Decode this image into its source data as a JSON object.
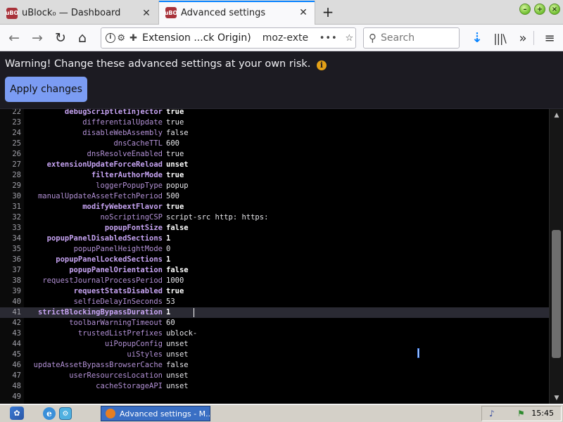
{
  "browser": {
    "tabs": [
      {
        "favicon": "uBO",
        "title": "uBlock₀ — Dashboard",
        "active": false
      },
      {
        "favicon": "uBO",
        "title": "Advanced settings",
        "active": true
      }
    ],
    "new_tab_icon": "+",
    "window_buttons": {
      "minimize": "–",
      "maximize": "+",
      "close": "×"
    },
    "nav": {
      "back_icon": "←",
      "forward_icon": "→",
      "reload_icon": "↻",
      "home_icon": "⌂",
      "identity_label": "Extension ...ck Origin)",
      "url": "moz-exte",
      "page_actions_icon": "•••",
      "bookmark_icon": "☆",
      "search_placeholder": "Search",
      "downloads_icon": "⇣",
      "library_icon": "|||\\",
      "overflow_icon": "»",
      "menu_icon": "≡"
    }
  },
  "page": {
    "warning": "Warning! Change these advanced settings at your own risk.",
    "warning_icon": "i",
    "apply_button": "Apply changes"
  },
  "editor": {
    "active_line": 41,
    "lines": [
      {
        "n": "22",
        "key": "debugScriptletInjector",
        "value": "true",
        "modified": true
      },
      {
        "n": "23",
        "key": "differentialUpdate",
        "value": "true",
        "modified": false
      },
      {
        "n": "24",
        "key": "disableWebAssembly",
        "value": "false",
        "modified": false
      },
      {
        "n": "25",
        "key": "dnsCacheTTL",
        "value": "600",
        "modified": false
      },
      {
        "n": "26",
        "key": "dnsResolveEnabled",
        "value": "true",
        "modified": false
      },
      {
        "n": "27",
        "key": "extensionUpdateForceReload",
        "value": "unset",
        "modified": true
      },
      {
        "n": "28",
        "key": "filterAuthorMode",
        "value": "true",
        "modified": true
      },
      {
        "n": "29",
        "key": "loggerPopupType",
        "value": "popup",
        "modified": false
      },
      {
        "n": "30",
        "key": "manualUpdateAssetFetchPeriod",
        "value": "500",
        "modified": false
      },
      {
        "n": "31",
        "key": "modifyWebextFlavor",
        "value": "true",
        "modified": true
      },
      {
        "n": "32",
        "key": "noScriptingCSP",
        "value": "script-src http: https:",
        "modified": false
      },
      {
        "n": "33",
        "key": "popupFontSize",
        "value": "false",
        "modified": true
      },
      {
        "n": "34",
        "key": "popupPanelDisabledSections",
        "value": "1",
        "modified": true
      },
      {
        "n": "35",
        "key": "popupPanelHeightMode",
        "value": "0",
        "modified": false
      },
      {
        "n": "36",
        "key": "popupPanelLockedSections",
        "value": "1",
        "modified": true
      },
      {
        "n": "37",
        "key": "popupPanelOrientation",
        "value": "false",
        "modified": true
      },
      {
        "n": "38",
        "key": "requestJournalProcessPeriod",
        "value": "1000",
        "modified": false
      },
      {
        "n": "39",
        "key": "requestStatsDisabled",
        "value": "true",
        "modified": true
      },
      {
        "n": "40",
        "key": "selfieDelayInSeconds",
        "value": "53",
        "modified": false
      },
      {
        "n": "41",
        "key": "strictBlockingBypassDuration",
        "value": "1",
        "modified": true
      },
      {
        "n": "42",
        "key": "toolbarWarningTimeout",
        "value": "60",
        "modified": false
      },
      {
        "n": "43",
        "key": "trustedListPrefixes",
        "value": "ublock-",
        "modified": false
      },
      {
        "n": "44",
        "key": "uiPopupConfig",
        "value": "unset",
        "modified": false
      },
      {
        "n": "45",
        "key": "uiStyles",
        "value": "unset",
        "modified": false
      },
      {
        "n": "46",
        "key": "updateAssetBypassBrowserCache",
        "value": "false",
        "modified": false
      },
      {
        "n": "47",
        "key": "userResourcesLocation",
        "value": "unset",
        "modified": false
      },
      {
        "n": "48",
        "key": "cacheStorageAPI",
        "value": "unset",
        "modified": false
      },
      {
        "n": "49",
        "key": "",
        "value": "",
        "modified": false
      }
    ],
    "scroll_up_icon": "▲",
    "scroll_down_icon": "▼"
  },
  "taskbar": {
    "start_icon": "✿",
    "quick_launch_ie": "e",
    "quick_launch_2": "⚙",
    "task_label": "Advanced settings - M...",
    "tray_icon1": "♪",
    "tray_icon2": "⚑",
    "clock": "15:45"
  },
  "colors": {
    "accent": "#0a84ff",
    "apply_button_bg": "#7b9cf3",
    "page_bg": "#1c1b22",
    "editor_bg": "#000000",
    "key_color": "#b391d6",
    "warning_icon": "#e3a017"
  }
}
